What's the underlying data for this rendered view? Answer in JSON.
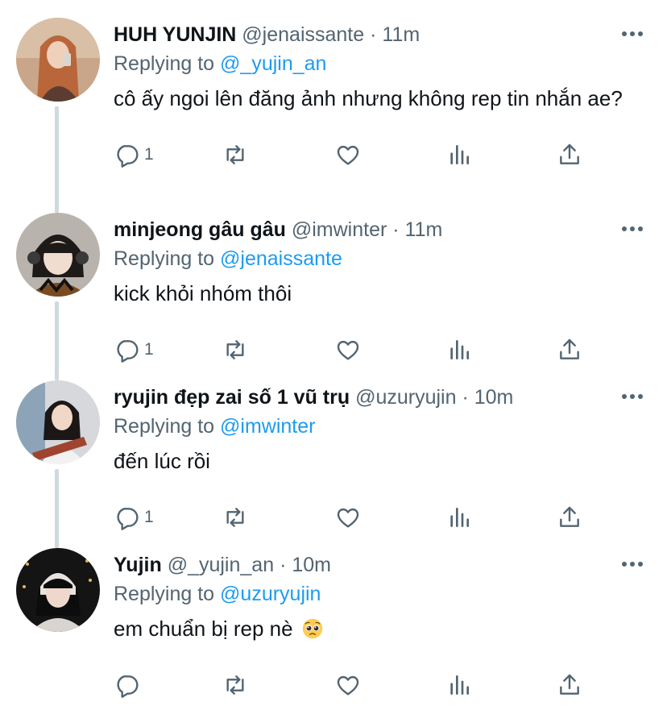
{
  "accent_color": "#1d9bf0",
  "muted_color": "#536471",
  "tweets": [
    {
      "name": "HUH YUNJIN",
      "handle": "@jenaissante",
      "separator": "·",
      "time": "11m",
      "replying_prefix": "Replying to",
      "replying_to": "@_yujin_an",
      "text": "cô ấy ngoi lên đăng ảnh nhưng không rep tin nhắn ae?",
      "reply_count": "1",
      "avatar_icon": "avatar-photo"
    },
    {
      "name": "minjeong gâu gâu",
      "handle": "@imwinter",
      "separator": "·",
      "time": "11m",
      "replying_prefix": "Replying to",
      "replying_to": "@jenaissante",
      "text": "kick khỏi nhóm thôi",
      "reply_count": "1",
      "avatar_icon": "avatar-photo"
    },
    {
      "name": "ryujin đẹp zai số 1 vũ trụ",
      "handle": "@uzuryujin",
      "separator": "·",
      "time": "10m",
      "replying_prefix": "Replying to",
      "replying_to": "@imwinter",
      "text": "đến lúc rồi",
      "reply_count": "1",
      "avatar_icon": "avatar-photo"
    },
    {
      "name": "Yujin",
      "handle": "@_yujin_an",
      "separator": "·",
      "time": "10m",
      "replying_prefix": "Replying to",
      "replying_to": "@uzuryujin",
      "text": "em chuẩn bị rep nè",
      "reply_count": "",
      "emoji": "pleading-face-emoji",
      "avatar_icon": "avatar-photo"
    }
  ],
  "action_icons": [
    "reply-icon",
    "retweet-icon",
    "like-icon",
    "analytics-icon",
    "share-icon"
  ]
}
